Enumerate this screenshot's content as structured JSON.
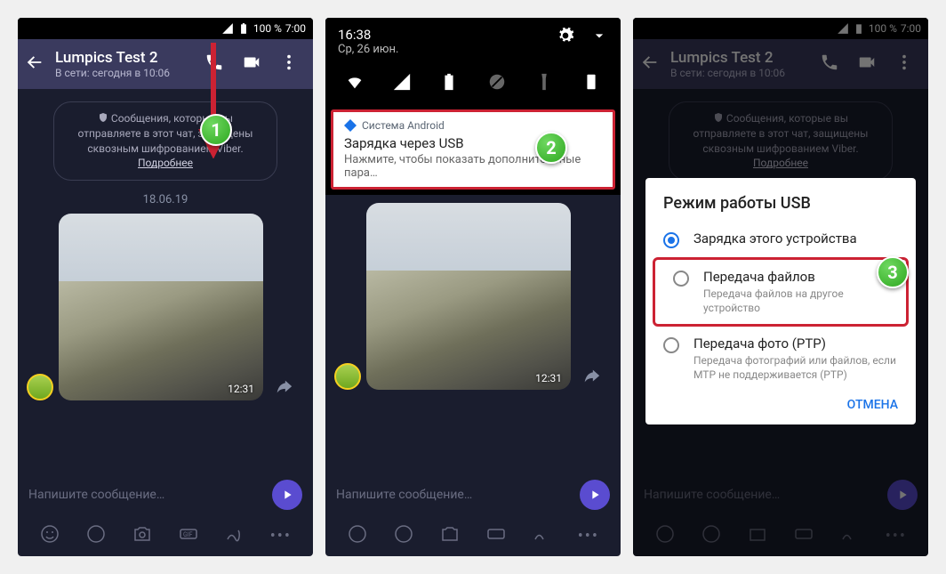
{
  "statusbar": {
    "battery": "100 %",
    "time": "7:00"
  },
  "header": {
    "name": "Lumpics Test 2",
    "status": "В сети: сегодня в 10:06"
  },
  "info": {
    "text": "Сообщения, которые вы отправляете в этот чат, защищены сквозным шифрованием Viber.",
    "more": "Подробнее"
  },
  "date": "18.06.19",
  "img_time": "12:31",
  "composer_placeholder": "Напишите сообщение…",
  "shade": {
    "time": "16:38",
    "date": "Ср, 26 июн."
  },
  "notif": {
    "system": "Система Android",
    "title": "Зарядка через USB",
    "sub": "Нажмите, чтобы показать дополнительные пара…"
  },
  "dialog": {
    "title": "Режим работы USB",
    "opt1": {
      "label": "Зарядка этого устройства"
    },
    "opt2": {
      "label": "Передача файлов",
      "sub": "Передача файлов на другое устройство"
    },
    "opt3": {
      "label": "Передача фото (PTP)",
      "sub": "Передача фотографий или файлов, если MTP не поддерживается (PTP)"
    },
    "cancel": "ОТМЕНА"
  },
  "badges": {
    "b1": "1",
    "b2": "2",
    "b3": "3"
  }
}
